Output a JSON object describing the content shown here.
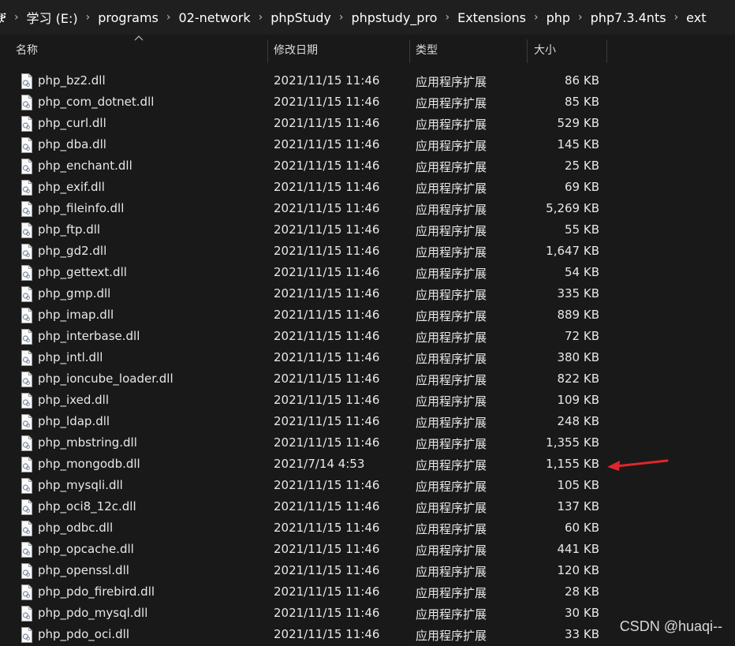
{
  "breadcrumb": [
    "ቛ",
    "学习 (E:)",
    "programs",
    "02-network",
    "phpStudy",
    "phpstudy_pro",
    "Extensions",
    "php",
    "php7.3.4nts",
    "ext"
  ],
  "header": {
    "name": "名称",
    "date": "修改日期",
    "type": "类型",
    "size": "大小"
  },
  "files": [
    {
      "name": "php_bz2.dll",
      "date": "2021/11/15 11:46",
      "type": "应用程序扩展",
      "size": "86 KB"
    },
    {
      "name": "php_com_dotnet.dll",
      "date": "2021/11/15 11:46",
      "type": "应用程序扩展",
      "size": "85 KB"
    },
    {
      "name": "php_curl.dll",
      "date": "2021/11/15 11:46",
      "type": "应用程序扩展",
      "size": "529 KB"
    },
    {
      "name": "php_dba.dll",
      "date": "2021/11/15 11:46",
      "type": "应用程序扩展",
      "size": "145 KB"
    },
    {
      "name": "php_enchant.dll",
      "date": "2021/11/15 11:46",
      "type": "应用程序扩展",
      "size": "25 KB"
    },
    {
      "name": "php_exif.dll",
      "date": "2021/11/15 11:46",
      "type": "应用程序扩展",
      "size": "69 KB"
    },
    {
      "name": "php_fileinfo.dll",
      "date": "2021/11/15 11:46",
      "type": "应用程序扩展",
      "size": "5,269 KB"
    },
    {
      "name": "php_ftp.dll",
      "date": "2021/11/15 11:46",
      "type": "应用程序扩展",
      "size": "55 KB"
    },
    {
      "name": "php_gd2.dll",
      "date": "2021/11/15 11:46",
      "type": "应用程序扩展",
      "size": "1,647 KB"
    },
    {
      "name": "php_gettext.dll",
      "date": "2021/11/15 11:46",
      "type": "应用程序扩展",
      "size": "54 KB"
    },
    {
      "name": "php_gmp.dll",
      "date": "2021/11/15 11:46",
      "type": "应用程序扩展",
      "size": "335 KB"
    },
    {
      "name": "php_imap.dll",
      "date": "2021/11/15 11:46",
      "type": "应用程序扩展",
      "size": "889 KB"
    },
    {
      "name": "php_interbase.dll",
      "date": "2021/11/15 11:46",
      "type": "应用程序扩展",
      "size": "72 KB"
    },
    {
      "name": "php_intl.dll",
      "date": "2021/11/15 11:46",
      "type": "应用程序扩展",
      "size": "380 KB"
    },
    {
      "name": "php_ioncube_loader.dll",
      "date": "2021/11/15 11:46",
      "type": "应用程序扩展",
      "size": "822 KB"
    },
    {
      "name": "php_ixed.dll",
      "date": "2021/11/15 11:46",
      "type": "应用程序扩展",
      "size": "109 KB"
    },
    {
      "name": "php_ldap.dll",
      "date": "2021/11/15 11:46",
      "type": "应用程序扩展",
      "size": "248 KB"
    },
    {
      "name": "php_mbstring.dll",
      "date": "2021/11/15 11:46",
      "type": "应用程序扩展",
      "size": "1,355 KB"
    },
    {
      "name": "php_mongodb.dll",
      "date": "2021/7/14 4:53",
      "type": "应用程序扩展",
      "size": "1,155 KB"
    },
    {
      "name": "php_mysqli.dll",
      "date": "2021/11/15 11:46",
      "type": "应用程序扩展",
      "size": "105 KB"
    },
    {
      "name": "php_oci8_12c.dll",
      "date": "2021/11/15 11:46",
      "type": "应用程序扩展",
      "size": "137 KB"
    },
    {
      "name": "php_odbc.dll",
      "date": "2021/11/15 11:46",
      "type": "应用程序扩展",
      "size": "60 KB"
    },
    {
      "name": "php_opcache.dll",
      "date": "2021/11/15 11:46",
      "type": "应用程序扩展",
      "size": "441 KB"
    },
    {
      "name": "php_openssl.dll",
      "date": "2021/11/15 11:46",
      "type": "应用程序扩展",
      "size": "120 KB"
    },
    {
      "name": "php_pdo_firebird.dll",
      "date": "2021/11/15 11:46",
      "type": "应用程序扩展",
      "size": "28 KB"
    },
    {
      "name": "php_pdo_mysql.dll",
      "date": "2021/11/15 11:46",
      "type": "应用程序扩展",
      "size": "30 KB"
    },
    {
      "name": "php_pdo_oci.dll",
      "date": "2021/11/15 11:46",
      "type": "应用程序扩展",
      "size": "33 KB"
    }
  ],
  "watermark": "CSDN @huaqi--",
  "colors": {
    "background": "#191919",
    "text": "#e6e6e6",
    "annotation_arrow": "#e0262b"
  },
  "icons": {
    "file": "dll-file-icon",
    "sort": "sort-ascending-icon",
    "annotation": "red-arrow-annotation"
  }
}
